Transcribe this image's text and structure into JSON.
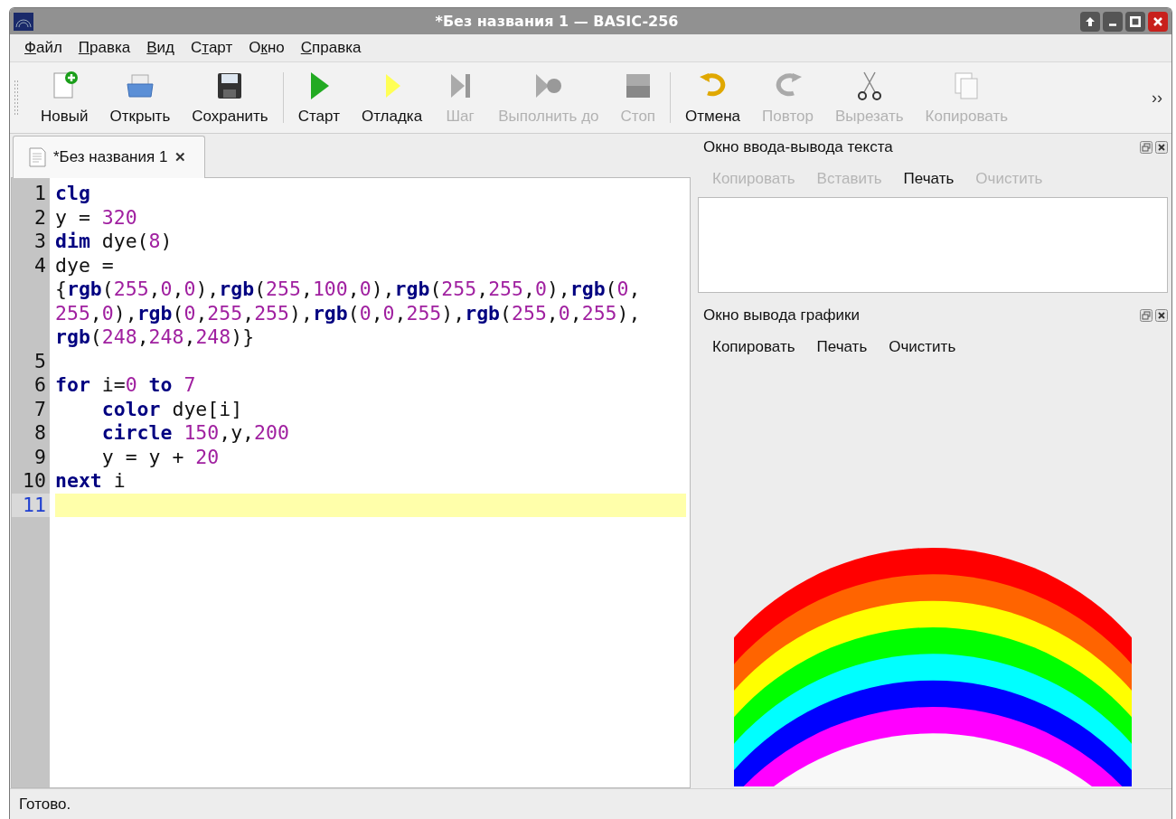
{
  "window": {
    "title": "*Без названия 1 — BASIC-256"
  },
  "menu": [
    {
      "key": "Ф",
      "post": "айл"
    },
    {
      "key": "П",
      "post": "равка"
    },
    {
      "key": "В",
      "post": "ид"
    },
    {
      "pre": "С",
      "key": "т",
      "post": "арт"
    },
    {
      "pre": "О",
      "key": "к",
      "post": "но"
    },
    {
      "key": "С",
      "post": "правка"
    }
  ],
  "toolbar": {
    "items": [
      {
        "kind": "new",
        "label": "Новый",
        "disabled": false
      },
      {
        "kind": "open",
        "label": "Открыть",
        "disabled": false
      },
      {
        "kind": "save",
        "label": "Сохранить",
        "disabled": false
      },
      {
        "kind": "separator"
      },
      {
        "kind": "run",
        "label": "Старт",
        "disabled": false
      },
      {
        "kind": "debug",
        "label": "Отладка",
        "disabled": false
      },
      {
        "kind": "step",
        "label": "Шаг",
        "disabled": true
      },
      {
        "kind": "runto",
        "label": "Выполнить до",
        "disabled": true
      },
      {
        "kind": "stop",
        "label": "Стоп",
        "disabled": true
      },
      {
        "kind": "separator"
      },
      {
        "kind": "undo",
        "label": "Отмена",
        "disabled": false
      },
      {
        "kind": "redo",
        "label": "Повтор",
        "disabled": true
      },
      {
        "kind": "cut",
        "label": "Вырезать",
        "disabled": true
      },
      {
        "kind": "copy",
        "label": "Копировать",
        "disabled": true
      }
    ],
    "overflow": "››"
  },
  "tabs": [
    {
      "label": "*Без названия 1",
      "close": "✕",
      "selected": true
    }
  ],
  "editor": {
    "lines": [
      {
        "number": "1",
        "current": false,
        "tokens": [
          {
            "kind": "keyword",
            "text": "clg"
          }
        ]
      },
      {
        "number": "2",
        "current": false,
        "tokens": [
          {
            "kind": "plain",
            "text": "y = "
          },
          {
            "kind": "number",
            "text": "320"
          }
        ]
      },
      {
        "number": "3",
        "current": false,
        "tokens": [
          {
            "kind": "keyword",
            "text": "dim"
          },
          {
            "kind": "plain",
            "text": " dye("
          },
          {
            "kind": "number",
            "text": "8"
          },
          {
            "kind": "plain",
            "text": ")"
          }
        ]
      },
      {
        "number": "4",
        "current": false,
        "tokens": [
          {
            "kind": "plain",
            "text": "dye = {"
          },
          {
            "kind": "keyword",
            "text": "rgb"
          },
          {
            "kind": "plain",
            "text": "("
          },
          {
            "kind": "number",
            "text": "255"
          },
          {
            "kind": "plain",
            "text": ","
          },
          {
            "kind": "number",
            "text": "0"
          },
          {
            "kind": "plain",
            "text": ","
          },
          {
            "kind": "number",
            "text": "0"
          },
          {
            "kind": "plain",
            "text": "),"
          },
          {
            "kind": "keyword",
            "text": "rgb"
          },
          {
            "kind": "plain",
            "text": "("
          },
          {
            "kind": "number",
            "text": "255"
          },
          {
            "kind": "plain",
            "text": ","
          },
          {
            "kind": "number",
            "text": "100"
          },
          {
            "kind": "plain",
            "text": ","
          },
          {
            "kind": "number",
            "text": "0"
          },
          {
            "kind": "plain",
            "text": "),"
          },
          {
            "kind": "keyword",
            "text": "rgb"
          },
          {
            "kind": "plain",
            "text": "("
          },
          {
            "kind": "number",
            "text": "255"
          },
          {
            "kind": "plain",
            "text": ","
          },
          {
            "kind": "number",
            "text": "255"
          },
          {
            "kind": "plain",
            "text": ","
          },
          {
            "kind": "number",
            "text": "0"
          },
          {
            "kind": "plain",
            "text": "),"
          },
          {
            "kind": "keyword",
            "text": "rgb"
          },
          {
            "kind": "plain",
            "text": "("
          },
          {
            "kind": "number",
            "text": "0"
          },
          {
            "kind": "plain",
            "text": ","
          },
          {
            "kind": "number",
            "text": "255"
          },
          {
            "kind": "plain",
            "text": ","
          },
          {
            "kind": "number",
            "text": "0"
          },
          {
            "kind": "plain",
            "text": "),"
          },
          {
            "kind": "keyword",
            "text": "rgb"
          },
          {
            "kind": "plain",
            "text": "("
          },
          {
            "kind": "number",
            "text": "0"
          },
          {
            "kind": "plain",
            "text": ","
          },
          {
            "kind": "number",
            "text": "255"
          },
          {
            "kind": "plain",
            "text": ","
          },
          {
            "kind": "number",
            "text": "255"
          },
          {
            "kind": "plain",
            "text": "),"
          },
          {
            "kind": "keyword",
            "text": "rgb"
          },
          {
            "kind": "plain",
            "text": "("
          },
          {
            "kind": "number",
            "text": "0"
          },
          {
            "kind": "plain",
            "text": ","
          },
          {
            "kind": "number",
            "text": "0"
          },
          {
            "kind": "plain",
            "text": ","
          },
          {
            "kind": "number",
            "text": "255"
          },
          {
            "kind": "plain",
            "text": "),"
          },
          {
            "kind": "keyword",
            "text": "rgb"
          },
          {
            "kind": "plain",
            "text": "("
          },
          {
            "kind": "number",
            "text": "255"
          },
          {
            "kind": "plain",
            "text": ","
          },
          {
            "kind": "number",
            "text": "0"
          },
          {
            "kind": "plain",
            "text": ","
          },
          {
            "kind": "number",
            "text": "255"
          },
          {
            "kind": "plain",
            "text": "),"
          },
          {
            "kind": "keyword",
            "text": "rgb"
          },
          {
            "kind": "plain",
            "text": "("
          },
          {
            "kind": "number",
            "text": "248"
          },
          {
            "kind": "plain",
            "text": ","
          },
          {
            "kind": "number",
            "text": "248"
          },
          {
            "kind": "plain",
            "text": ","
          },
          {
            "kind": "number",
            "text": "248"
          },
          {
            "kind": "plain",
            "text": ")}"
          }
        ]
      },
      {
        "number": "5",
        "current": false
      },
      {
        "number": "6",
        "current": false,
        "tokens": [
          {
            "kind": "keyword",
            "text": "for"
          },
          {
            "kind": "plain",
            "text": " i="
          },
          {
            "kind": "number",
            "text": "0 "
          },
          {
            "kind": "keyword",
            "text": "to"
          },
          {
            "kind": "number",
            "text": " 7"
          }
        ]
      },
      {
        "number": "7",
        "current": false,
        "tokens": [
          {
            "kind": "keyword",
            "text": "    color"
          },
          {
            "kind": "plain",
            "text": " dye[i]"
          }
        ]
      },
      {
        "number": "8",
        "current": false,
        "tokens": [
          {
            "kind": "keyword",
            "text": "    circle"
          },
          {
            "kind": "number",
            "text": " 150"
          },
          {
            "kind": "plain",
            "text": ",y,"
          },
          {
            "kind": "number",
            "text": "200"
          }
        ]
      },
      {
        "number": "9",
        "current": false,
        "tokens": [
          {
            "kind": "plain",
            "text": "    y = y + "
          },
          {
            "kind": "number",
            "text": "20"
          }
        ]
      },
      {
        "number": "10",
        "current": false,
        "tokens": [
          {
            "kind": "keyword",
            "text": "next"
          },
          {
            "kind": "plain",
            "text": " i"
          }
        ]
      },
      {
        "number": "11",
        "current": true
      }
    ]
  },
  "text_output": {
    "title": "Окно ввода-вывода текста",
    "buttons": [
      {
        "label": "Копировать",
        "disabled": true
      },
      {
        "label": "Вставить",
        "disabled": true
      },
      {
        "label": "Печать",
        "disabled": false
      },
      {
        "label": "Очистить",
        "disabled": true
      }
    ]
  },
  "graphics_output": {
    "title": "Окно вывода графики",
    "buttons": [
      {
        "label": "Копировать",
        "disabled": false
      },
      {
        "label": "Печать",
        "disabled": false
      },
      {
        "label": "Очистить",
        "disabled": false
      }
    ]
  },
  "status_bar": {
    "text": "Готово."
  }
}
